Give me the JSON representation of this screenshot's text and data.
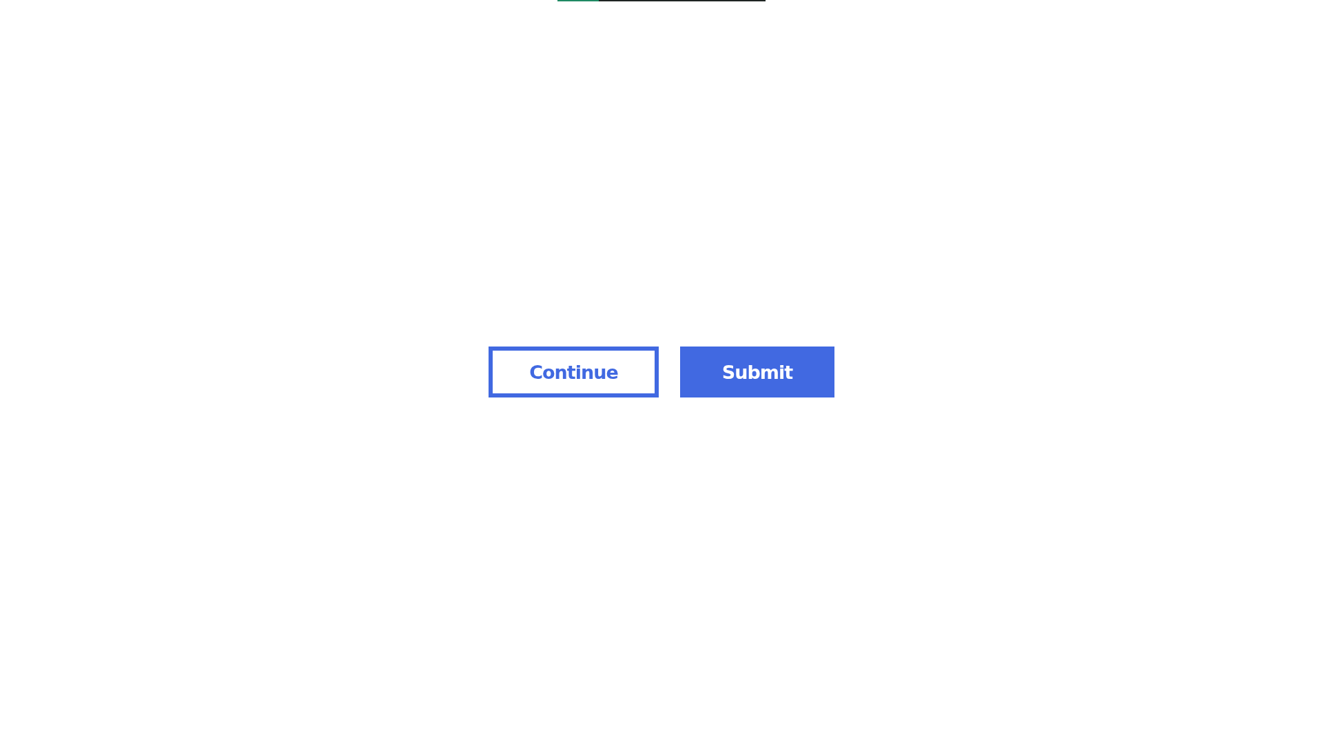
{
  "progress": {
    "level": 0.2
  },
  "buttons": [
    {
      "label": "Continue",
      "kind": "outline"
    },
    {
      "label": "Submit",
      "kind": "filled"
    }
  ]
}
